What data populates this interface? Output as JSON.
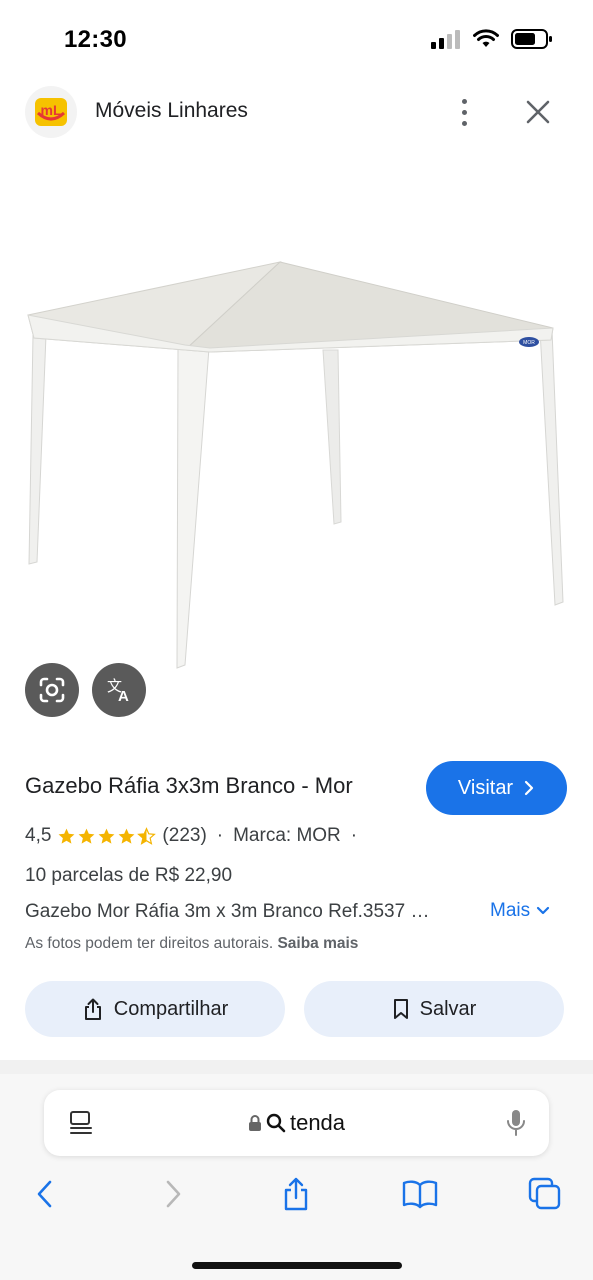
{
  "status_bar": {
    "time": "12:30"
  },
  "header": {
    "site_name": "Móveis Linhares",
    "logo_text": "mL"
  },
  "image": {
    "badge_text": "MOR"
  },
  "product": {
    "title": "Gazebo Ráfia 3x3m Branco - Mor",
    "visit_label": "Visitar",
    "rating_value": "4,5",
    "rating_stars": 4.5,
    "review_count": "(223)",
    "separator": "·",
    "brand": "Marca: MOR",
    "separator_end": "·",
    "installments": "10 parcelas de R$ 22,90",
    "description": "Gazebo Mor Ráfia 3m x 3m Branco Ref.3537 …",
    "more_label": "Mais",
    "copyright_text": "As fotos podem ter direitos autorais.",
    "learn_more": "Saiba mais",
    "share_label": "Compartilhar",
    "save_label": "Salvar"
  },
  "browser": {
    "address": "tenda"
  },
  "colors": {
    "accent": "#1a73e8",
    "star": "#f4b400",
    "pill_bg": "#e8effa"
  }
}
